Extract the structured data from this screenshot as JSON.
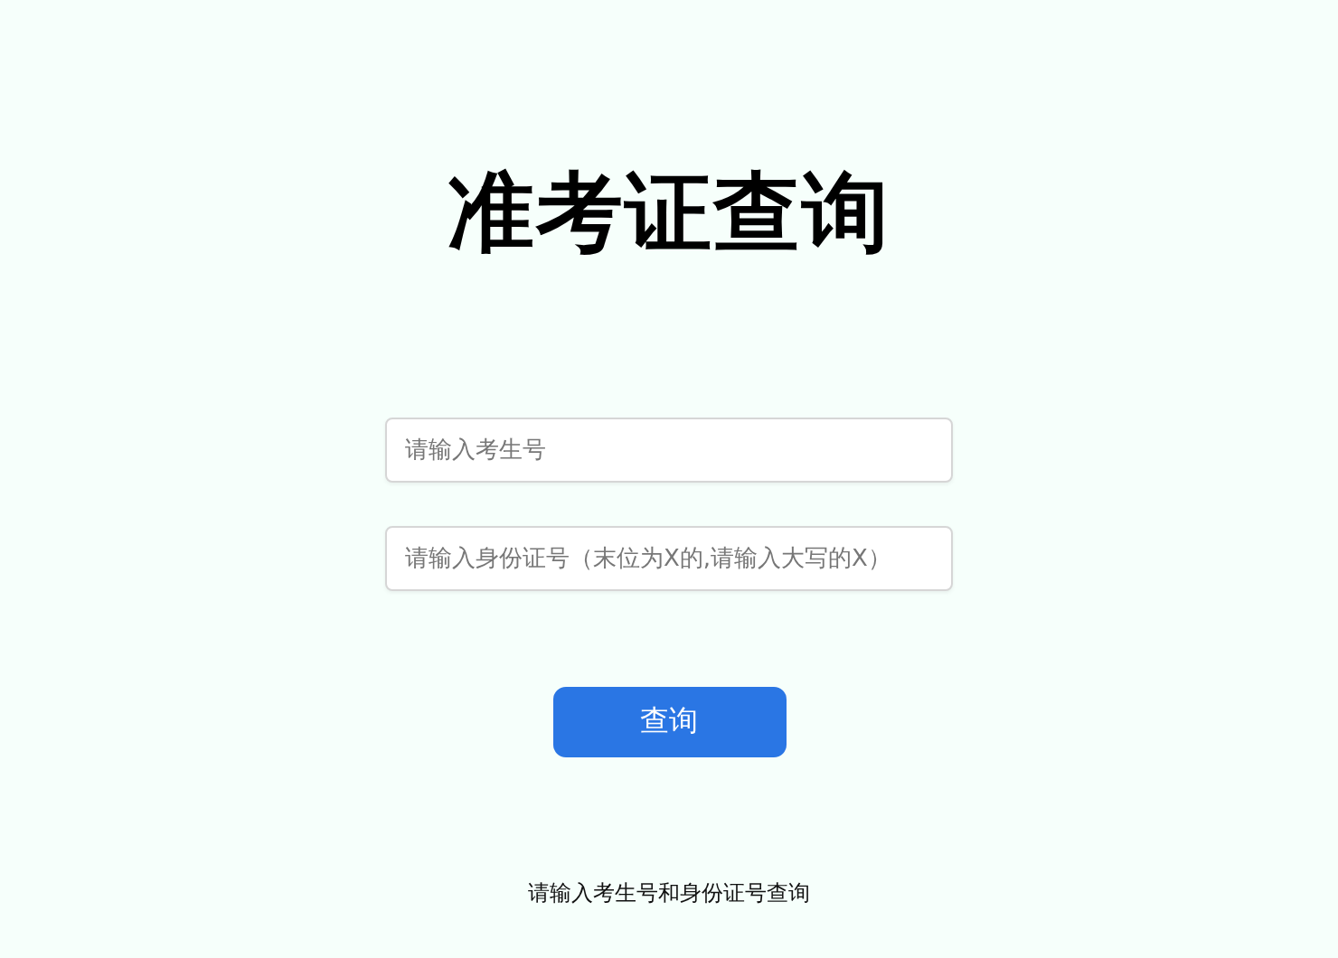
{
  "title": "准考证查询",
  "fields": [
    {
      "placeholder": "请输入考生号"
    },
    {
      "placeholder": "请输入身份证号（末位为X的,请输入大写的X）"
    }
  ],
  "button": "查询",
  "hint": "请输入考生号和身份证号查询"
}
